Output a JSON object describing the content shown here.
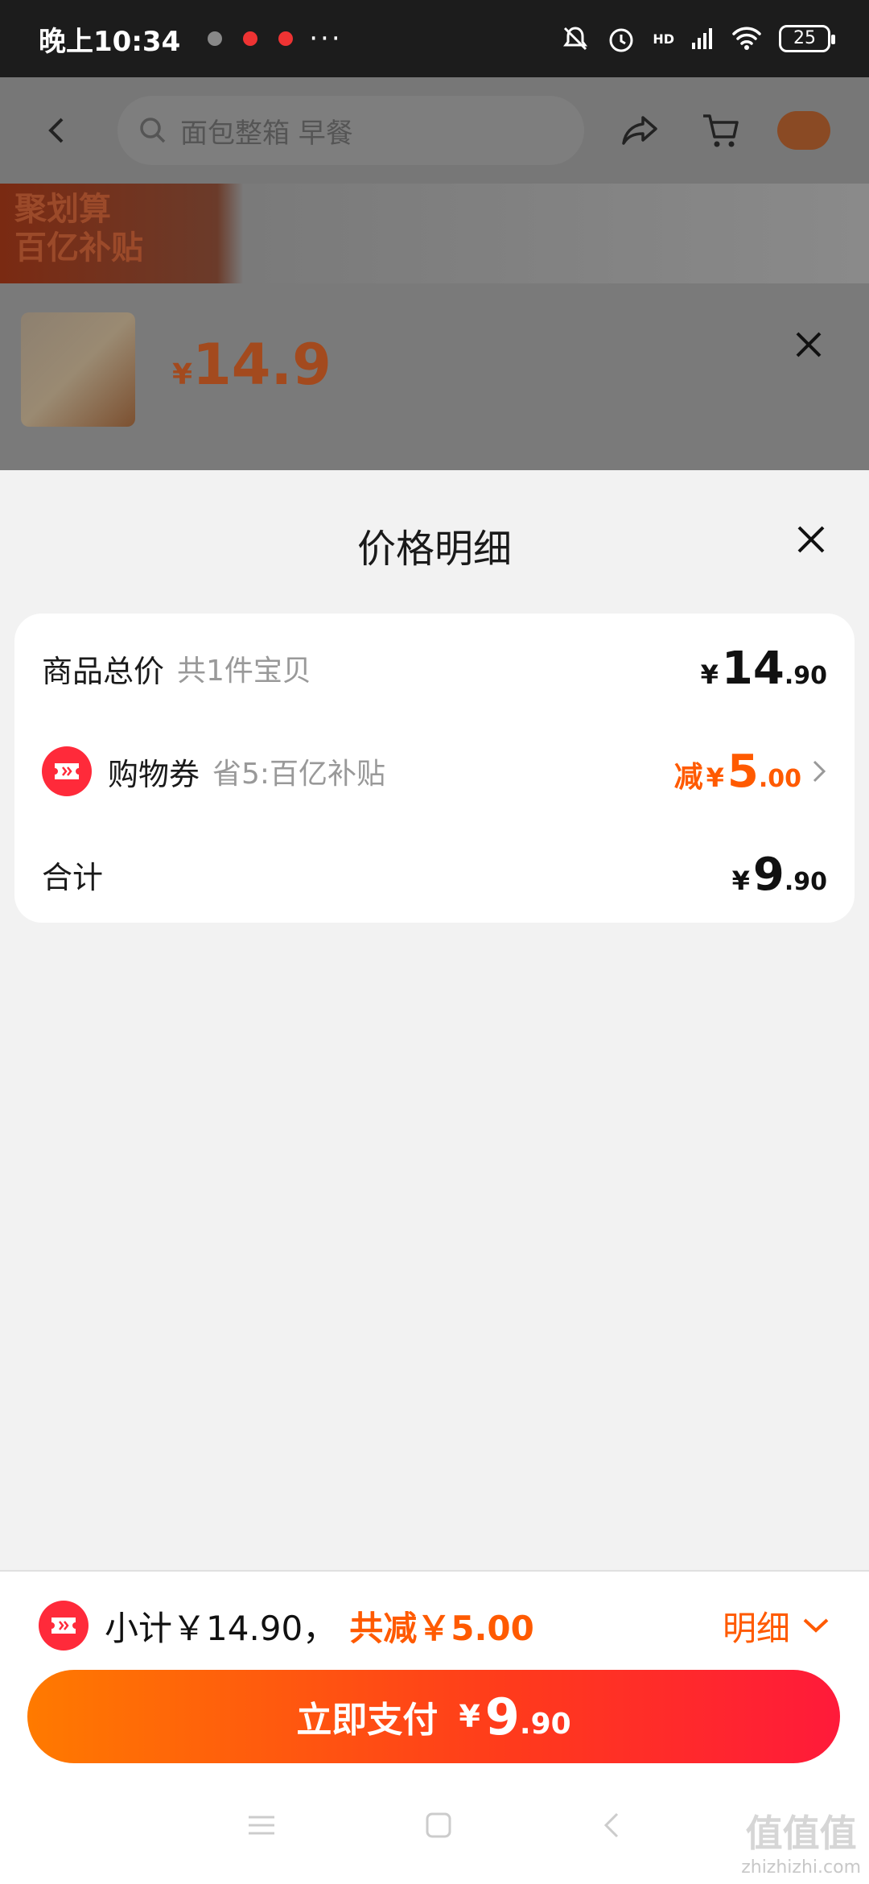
{
  "status_bar": {
    "time": "晚上10:34",
    "dots": "···",
    "signal_label": "HD",
    "battery": "25"
  },
  "background": {
    "search_placeholder": "面包整箱 早餐",
    "banner_line1": "聚划算",
    "banner_line2": "百亿补贴",
    "product_currency": "¥",
    "product_price": "14.9"
  },
  "sheet": {
    "title": "价格明细",
    "rows": {
      "total": {
        "label": "商品总价",
        "sub": "共1件宝贝",
        "currency": "¥",
        "int": "14",
        "dec": ".90"
      },
      "coupon": {
        "label": "购物券",
        "sub": "省5:百亿补贴",
        "prefix": "减",
        "currency": "¥",
        "int": "5",
        "dec": ".00"
      },
      "sum": {
        "label": "合计",
        "currency": "¥",
        "int": "9",
        "dec": ".90"
      }
    }
  },
  "footer": {
    "subtotal_text": "小计￥14.90，",
    "reduce_text": "共减￥5.00",
    "detail_label": "明细",
    "pay_label": "立即支付",
    "pay_currency": "¥",
    "pay_int": "9",
    "pay_dec": ".90"
  },
  "watermark": {
    "logo": "值值值",
    "domain": "zhizhizhi.com"
  },
  "colors": {
    "accent": "#ff5a00",
    "coupon_red": "#ff2a3a",
    "pay_gradient_start": "#ff7a00",
    "pay_gradient_end": "#ff1a3a"
  }
}
